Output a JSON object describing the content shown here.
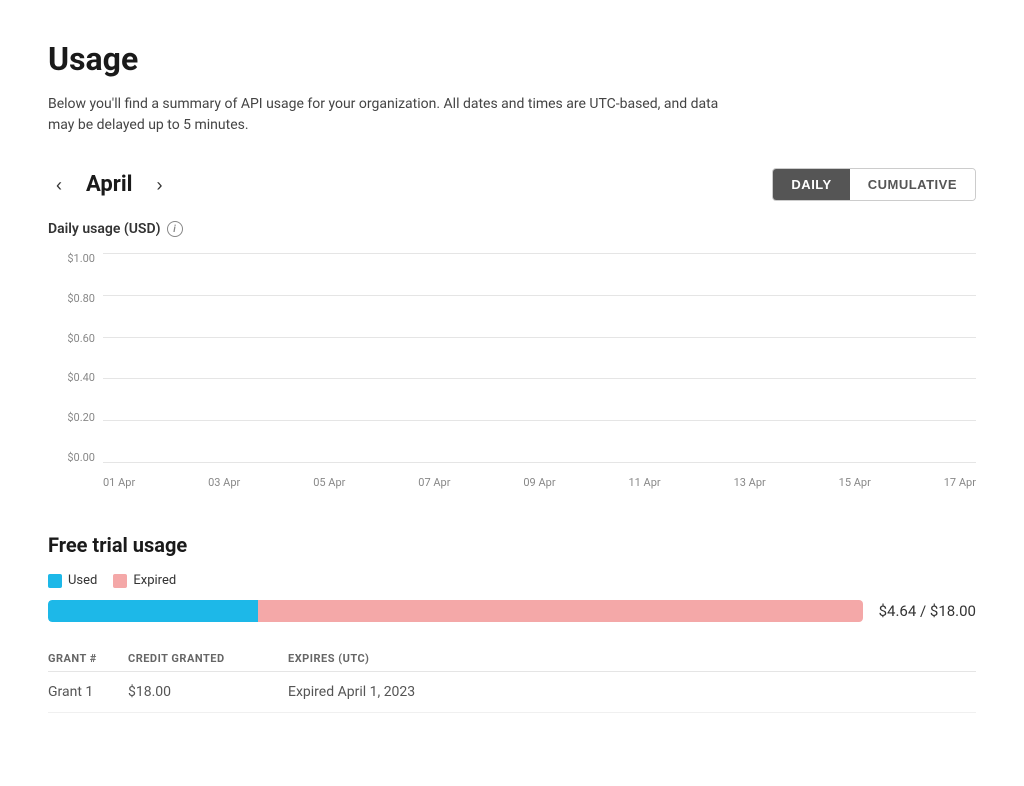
{
  "page": {
    "title": "Usage",
    "subtitle": "Below you'll find a summary of API usage for your organization. All dates and times are UTC-based, and data may be delayed up to 5 minutes."
  },
  "nav": {
    "prev_arrow": "‹",
    "next_arrow": "›",
    "month": "April"
  },
  "toggle": {
    "daily_label": "DAILY",
    "cumulative_label": "CUMULATIVE",
    "active": "daily"
  },
  "chart": {
    "title": "Daily usage (USD)",
    "y_labels": [
      "$1.00",
      "$0.80",
      "$0.60",
      "$0.40",
      "$0.20",
      "$0.00"
    ],
    "x_labels": [
      "01 Apr",
      "03 Apr",
      "05 Apr",
      "07 Apr",
      "09 Apr",
      "11 Apr",
      "13 Apr",
      "15 Apr",
      "17 Apr"
    ]
  },
  "free_trial": {
    "section_title": "Free trial usage",
    "legend_used": "Used",
    "legend_expired": "Expired",
    "used_percent": 25.8,
    "expired_percent": 74.2,
    "progress_label": "$4.64 / $18.00",
    "colors": {
      "used": "#1db8e8",
      "expired": "#f4a8a8"
    }
  },
  "grants_table": {
    "columns": [
      "GRANT #",
      "CREDIT GRANTED",
      "EXPIRES (UTC)"
    ],
    "rows": [
      {
        "grant": "Grant 1",
        "credit": "$18.00",
        "expires": "Expired April 1, 2023"
      }
    ]
  }
}
